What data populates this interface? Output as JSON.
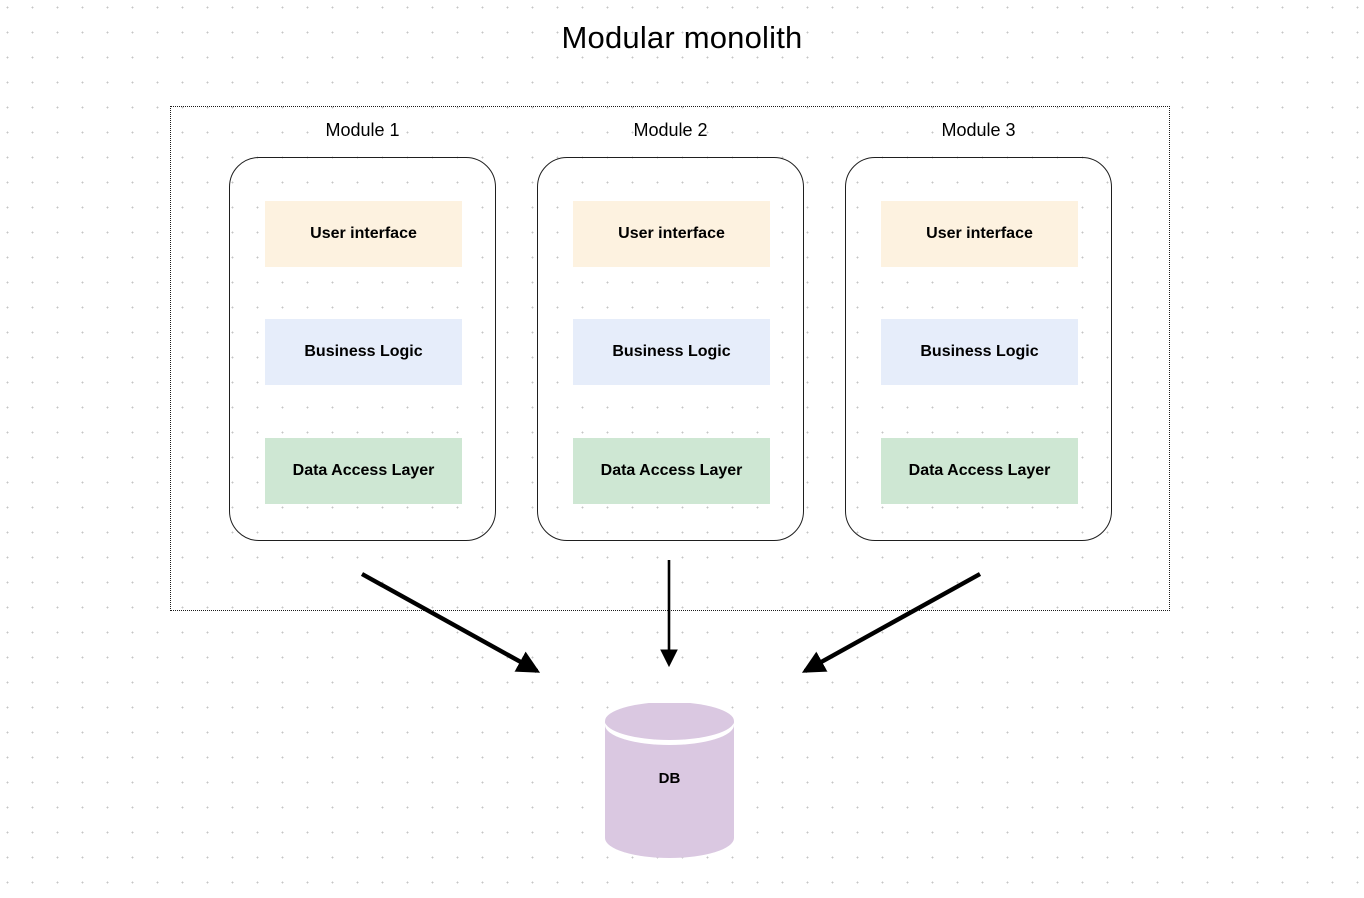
{
  "diagram": {
    "title": "Modular monolith",
    "boundary_name": "monolith-boundary",
    "modules": [
      {
        "label": "Module 1",
        "layers": [
          {
            "id": "ui",
            "label": "User interface",
            "color": "#fdf2e0"
          },
          {
            "id": "business",
            "label": "Business Logic",
            "color": "#e6edfa"
          },
          {
            "id": "data",
            "label": "Data Access Layer",
            "color": "#cee7d3"
          }
        ]
      },
      {
        "label": "Module 2",
        "layers": [
          {
            "id": "ui",
            "label": "User interface",
            "color": "#fdf2e0"
          },
          {
            "id": "business",
            "label": "Business Logic",
            "color": "#e6edfa"
          },
          {
            "id": "data",
            "label": "Data Access Layer",
            "color": "#cee7d3"
          }
        ]
      },
      {
        "label": "Module 3",
        "layers": [
          {
            "id": "ui",
            "label": "User interface",
            "color": "#fdf2e0"
          },
          {
            "id": "business",
            "label": "Business Logic",
            "color": "#e6edfa"
          },
          {
            "id": "data",
            "label": "Data Access Layer",
            "color": "#cee7d3"
          }
        ]
      }
    ],
    "database": {
      "label": "DB",
      "color": "#dac8e1",
      "top_color": "#dac8e1"
    },
    "connectors": [
      {
        "name": "module-1-to-db",
        "from": "Module 1",
        "to": "DB"
      },
      {
        "name": "module-2-to-db",
        "from": "Module 2",
        "to": "DB"
      },
      {
        "name": "module-3-to-db",
        "from": "Module 3",
        "to": "DB"
      }
    ],
    "colors": {
      "canvas_background": "#ffffff",
      "grid_dot": "#c5c5c5",
      "stroke": "#1f1f1f",
      "boundary_stroke": "#1b1b1b",
      "text": "#000000"
    }
  }
}
